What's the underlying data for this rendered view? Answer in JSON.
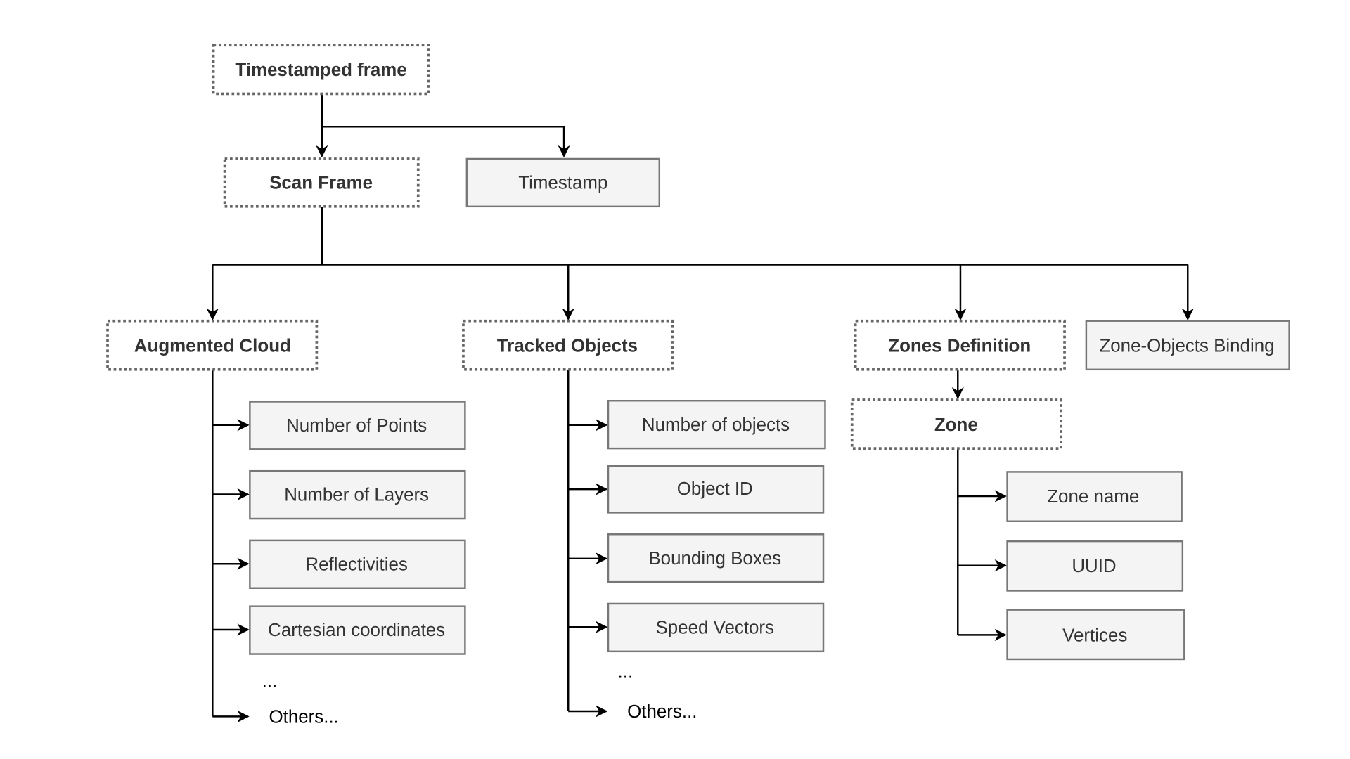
{
  "root": "Timestamped frame",
  "scan_frame": "Scan Frame",
  "timestamp": "Timestamp",
  "augmented_cloud": {
    "title": "Augmented Cloud",
    "items": [
      "Number of Points",
      "Number of Layers",
      "Reflectivities",
      "Cartesian coordinates"
    ],
    "ellipsis": "...",
    "others": "Others..."
  },
  "tracked_objects": {
    "title": "Tracked Objects",
    "items": [
      "Number of objects",
      "Object ID",
      "Bounding Boxes",
      "Speed Vectors"
    ],
    "ellipsis": "...",
    "others": "Others..."
  },
  "zones_definition": {
    "title": "Zones Definition",
    "zone": "Zone",
    "items": [
      "Zone name",
      "UUID",
      "Vertices"
    ]
  },
  "zone_objects_binding": "Zone-Objects Binding"
}
